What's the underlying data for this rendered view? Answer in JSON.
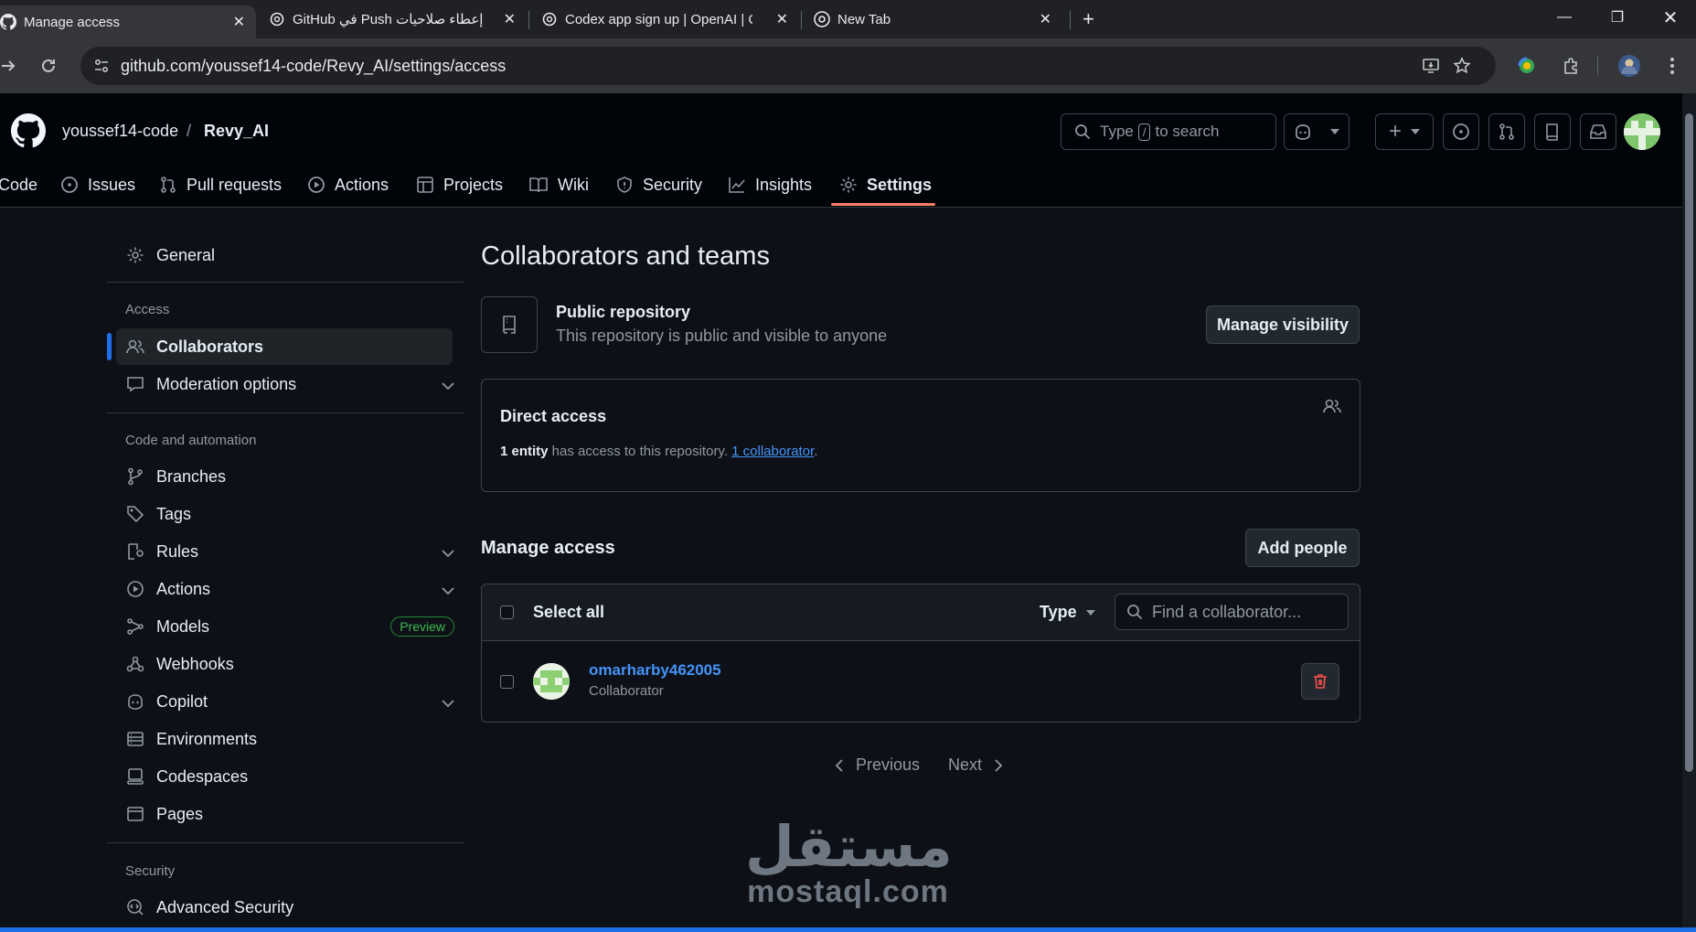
{
  "browser": {
    "tabs": [
      {
        "title": "Manage access"
      },
      {
        "title": "إعطاء صلاحيات Push في GitHub"
      },
      {
        "title": "Codex app sign up | OpenAI | C"
      },
      {
        "title": "New Tab"
      }
    ],
    "url": "github.com/youssef14-code/Revy_AI/settings/access"
  },
  "header": {
    "owner": "youssef14-code",
    "separator": "/",
    "repo": "Revy_AI",
    "search_pre": "Type",
    "search_key": "/",
    "search_post": "to search"
  },
  "repo_nav": {
    "items": [
      {
        "label": "Code"
      },
      {
        "label": "Issues"
      },
      {
        "label": "Pull requests"
      },
      {
        "label": "Actions"
      },
      {
        "label": "Projects"
      },
      {
        "label": "Wiki"
      },
      {
        "label": "Security"
      },
      {
        "label": "Insights"
      },
      {
        "label": "Settings"
      }
    ],
    "selected": "Settings"
  },
  "sidebar": {
    "general": "General",
    "access_heading": "Access",
    "collaborators": "Collaborators",
    "moderation": "Moderation options",
    "code_heading": "Code and automation",
    "branches": "Branches",
    "tags": "Tags",
    "rules": "Rules",
    "actions": "Actions",
    "models": "Models",
    "models_badge": "Preview",
    "webhooks": "Webhooks",
    "copilot": "Copilot",
    "environments": "Environments",
    "codespaces": "Codespaces",
    "pages": "Pages",
    "security_heading": "Security",
    "advanced_security": "Advanced Security"
  },
  "main": {
    "title": "Collaborators and teams",
    "visibility_title": "Public repository",
    "visibility_desc": "This repository is public and visible to anyone",
    "manage_visibility": "Manage visibility",
    "direct_access_title": "Direct access",
    "direct_access_count": "1 entity",
    "direct_access_mid": " has access to this repository. ",
    "direct_access_link": "1 collaborator",
    "direct_access_end": ".",
    "manage_access_title": "Manage access",
    "add_people": "Add people",
    "select_all": "Select all",
    "type_filter": "Type",
    "find_placeholder": "Find a collaborator...",
    "collaborators": [
      {
        "username": "omarharby462005",
        "role": "Collaborator"
      }
    ],
    "pager_previous": "Previous",
    "pager_next": "Next"
  },
  "watermark": {
    "arabic": "مستقل",
    "latin": "mostaql.com"
  },
  "colors": {
    "bg": "#0d1117",
    "accent_link": "#4493f8",
    "selected_underline": "#f78166",
    "danger": "#f85149",
    "success": "#3fb950"
  }
}
